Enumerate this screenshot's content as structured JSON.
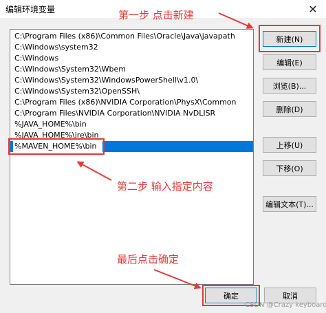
{
  "window": {
    "title": "编辑环境变量",
    "close_glyph": "✕"
  },
  "paths": [
    "C:\\Program Files (x86)\\Common Files\\Oracle\\Java\\javapath",
    "C:\\Windows\\system32",
    "C:\\Windows",
    "C:\\Windows\\System32\\Wbem",
    "C:\\Windows\\System32\\WindowsPowerShell\\v1.0\\",
    "C:\\Windows\\System32\\OpenSSH\\",
    "C:\\Program Files (x86)\\NVIDIA Corporation\\PhysX\\Common",
    "C:\\Program Files\\NVIDIA Corporation\\NVIDIA NvDLISR",
    "%JAVA_HOME%\\bin",
    "%JAVA_HOME%\\jre\\bin"
  ],
  "editing_value": "%MAVEN_HOME%\\bin",
  "buttons": {
    "new": "新建(N)",
    "edit": "编辑(E)",
    "browse": "浏览(B)...",
    "delete": "删除(D)",
    "move_up": "上移(U)",
    "move_down": "下移(O)",
    "edit_text": "编辑文本(T)...",
    "ok": "确定",
    "cancel": "取消"
  },
  "annotations": {
    "step1": "第一步 点击新建",
    "step2": "第二步 输入指定内容",
    "step3": "最后点击确定"
  },
  "watermark": "CSDN @Crazy keyboard",
  "colors": {
    "accent": "#0078d7",
    "annotation": "#e53935"
  }
}
